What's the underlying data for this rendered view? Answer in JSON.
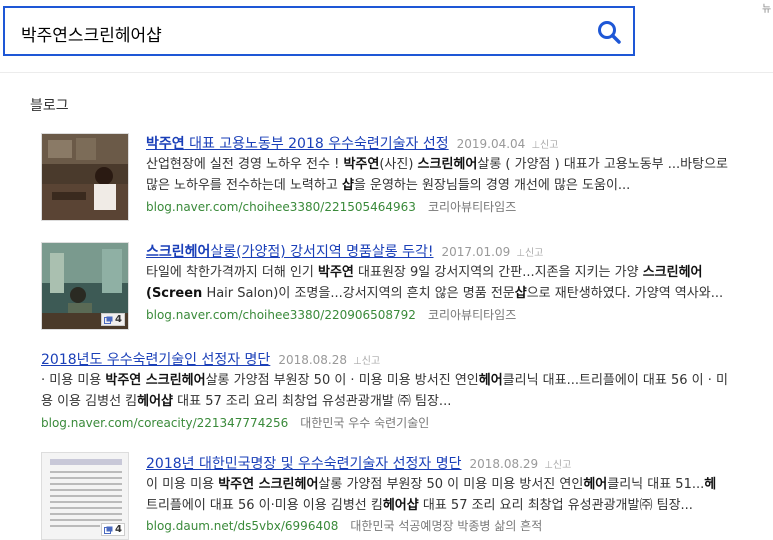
{
  "search": {
    "value": "박주연스크린헤어샵"
  },
  "corner": {
    "text": "뉴"
  },
  "section": {
    "title": "블로그"
  },
  "results": [
    {
      "title_bold": "박주연",
      "title_rest": " 대표 고용노동부 2018 우수숙련기술자 선정",
      "date": "2019.04.04",
      "report": "신고",
      "line1": [
        {
          "t": "산업현장에 실전 경영 노하우 전수 ! ",
          "b": false
        },
        {
          "t": "박주연",
          "b": true
        },
        {
          "t": "(사진) ",
          "b": false
        },
        {
          "t": "스크린헤어",
          "b": true
        },
        {
          "t": "살롱 ( 가양점 ) 대표가 고용노동부 ...바탕으로",
          "b": false
        }
      ],
      "line2": [
        {
          "t": "많은 노하우를 전수하는데 노력하고 ",
          "b": false
        },
        {
          "t": "샵",
          "b": true
        },
        {
          "t": "을 운영하는 원장님들의 경영 개선에 많은 도움이...",
          "b": false
        }
      ],
      "url": "blog.naver.com/choihee3380/221505464963",
      "blog": "코리아뷰티타임즈"
    },
    {
      "title_bold": "스크린헤어",
      "title_rest": "살롱(가양점) 강서지역 명품살롱 두각!",
      "date": "2017.01.09",
      "report": "신고",
      "line1": [
        {
          "t": "타일에 착한가격까지 더해 인기 ",
          "b": false
        },
        {
          "t": "박주연",
          "b": true
        },
        {
          "t": " 대표원장 9일 강서지역의 간판...지존을 지키는 가양 ",
          "b": false
        },
        {
          "t": "스크린헤어",
          "b": true
        }
      ],
      "line2": [
        {
          "t": "(Screen",
          "b": true
        },
        {
          "t": " Hair Salon)이 조명을...강서지역의 흔치 않은 명품 전문",
          "b": false
        },
        {
          "t": "샵",
          "b": true
        },
        {
          "t": "으로 재탄생하였다. 가양역 역사와...",
          "b": false
        }
      ],
      "url": "blog.naver.com/choihee3380/220906508792",
      "blog": "코리아뷰티타임즈",
      "badge": "4"
    },
    {
      "title_bold": "",
      "title_rest": "2018년도 우수숙련기술인 선정자 명단",
      "date": "2018.08.28",
      "report": "신고",
      "line1": [
        {
          "t": "· 미용 미용 ",
          "b": false
        },
        {
          "t": "박주연 스크린헤어",
          "b": true
        },
        {
          "t": "살롱 가양점 부원장 50 이 · 미용 미용 방서진 연인",
          "b": false
        },
        {
          "t": "헤어",
          "b": true
        },
        {
          "t": "클리닉 대표...트리플에이 대표 56 이 · 미",
          "b": false
        }
      ],
      "line2": [
        {
          "t": "용 이용 김병선 킴",
          "b": false
        },
        {
          "t": "헤어샵",
          "b": true
        },
        {
          "t": " 대표 57 조리 요리 최창업 유성관광개발 ㈜ 팀장...",
          "b": false
        }
      ],
      "url": "blog.naver.com/coreacity/221347774256",
      "blog": "대한민국 우수 숙련기술인"
    },
    {
      "title_bold": "",
      "title_rest": "2018년 대한민국명장 및 우수숙련기술자 선정자 명단",
      "date": "2018.08.29",
      "report": "신고",
      "line1": [
        {
          "t": "이 미용 미용 ",
          "b": false
        },
        {
          "t": "박주연 스크린헤어",
          "b": true
        },
        {
          "t": "살롱 가양점 부원장 50 이 미용 미용 방서진 연인",
          "b": false
        },
        {
          "t": "헤어",
          "b": true
        },
        {
          "t": "클리닉 대표 51...",
          "b": false
        },
        {
          "t": "헤",
          "b": true
        }
      ],
      "line2": [
        {
          "t": "트리플에이 대표 56 이·미용 이용 김병선 킴",
          "b": false
        },
        {
          "t": "헤어샵",
          "b": true
        },
        {
          "t": " 대표 57 조리 요리 최창업 유성관광개발㈜ 팀장...",
          "b": false
        }
      ],
      "url": "blog.daum.net/ds5vbx/6996408",
      "blog": "대한민국 석공예명장 박종병 삶의 흔적",
      "badge": "4"
    }
  ],
  "colors": {
    "accent": "#1e57d6",
    "link": "#1a3fb8",
    "url": "#3a8a3a"
  }
}
